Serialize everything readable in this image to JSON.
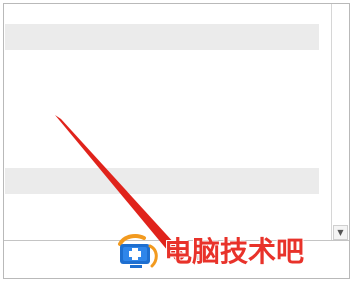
{
  "window": {
    "scrollbar": {
      "down_glyph": "▼"
    }
  },
  "watermark": {
    "text": "电脑技术吧",
    "logo_icon": "monitor-plus-logo",
    "text_color": "#e8322a",
    "logo_colors": [
      "#1e6fd0",
      "#f29a1f"
    ]
  },
  "annotation": {
    "type": "arrow",
    "color": "#e0231b"
  }
}
